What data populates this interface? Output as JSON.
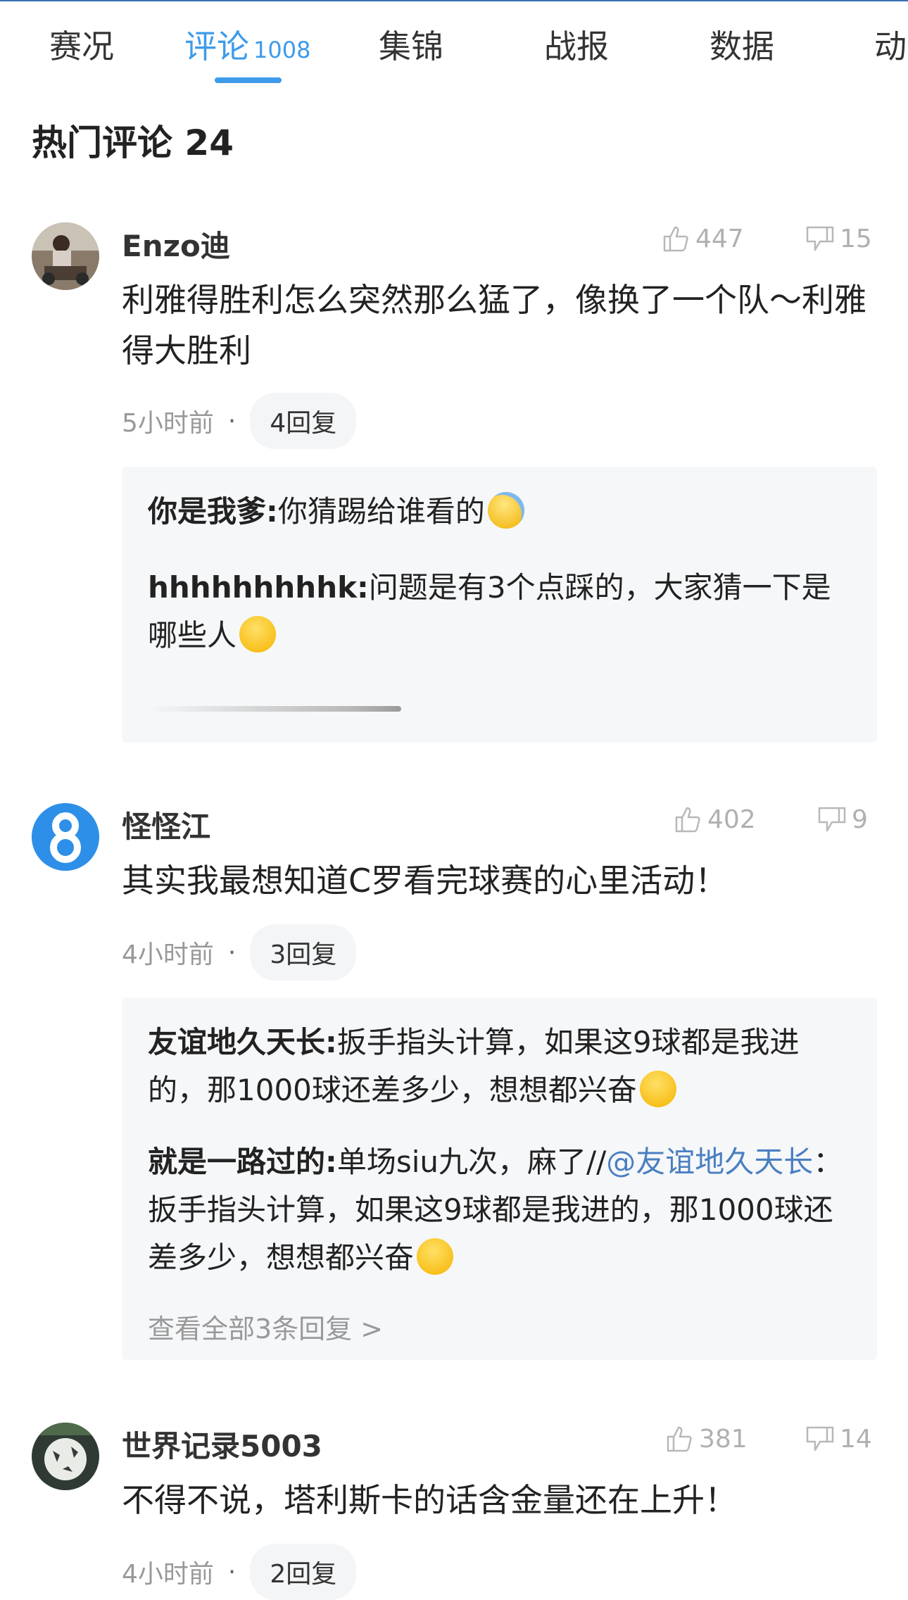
{
  "tabs": [
    {
      "label": "赛况"
    },
    {
      "label": "评论",
      "count": "1008"
    },
    {
      "label": "集锦"
    },
    {
      "label": "战报"
    },
    {
      "label": "数据"
    },
    {
      "label": "动"
    }
  ],
  "section_title": "热门评论 24",
  "comments": [
    {
      "user": "Enzo迪",
      "likes": "447",
      "dislikes": "15",
      "text": "利雅得胜利怎么突然那么猛了，像换了一个队～利雅得大胜利",
      "time": "5小时前",
      "reply_count": "4回复",
      "replies": [
        {
          "user": "你是我爹",
          "sep": ":",
          "text": "你猜踢给谁看的"
        },
        {
          "user": "hhhhhhhhhk",
          "sep": ":",
          "text": "问题是有3个点踩的，大家猜一下是哪些人"
        }
      ]
    },
    {
      "user": "怪怪江",
      "likes": "402",
      "dislikes": "9",
      "text": "其实我最想知道C罗看完球赛的心里活动！",
      "time": "4小时前",
      "reply_count": "3回复",
      "replies": [
        {
          "user": "友谊地久天长",
          "sep": ":",
          "text": "扳手指头计算，如果这9球都是我进的，那1000球还差多少，想想都兴奋"
        },
        {
          "user": "就是一路过的",
          "sep": ":",
          "text": "单场siu九次，麻了//",
          "mention": "@友谊地久天长",
          "text2": "：扳手指头计算，如果这9球都是我进的，那1000球还差多少，想想都兴奋"
        }
      ],
      "view_all": "查看全部3条回复 >"
    },
    {
      "user": "世界记录5003",
      "likes": "381",
      "dislikes": "14",
      "text": "不得不说，塔利斯卡的话含金量还在上升！",
      "time": "4小时前",
      "reply_count": "2回复"
    }
  ],
  "colors": {
    "accent": "#3d9bea",
    "mention": "#4a7fc1",
    "muted": "#999999",
    "reply_bg": "#f6f7f9"
  }
}
